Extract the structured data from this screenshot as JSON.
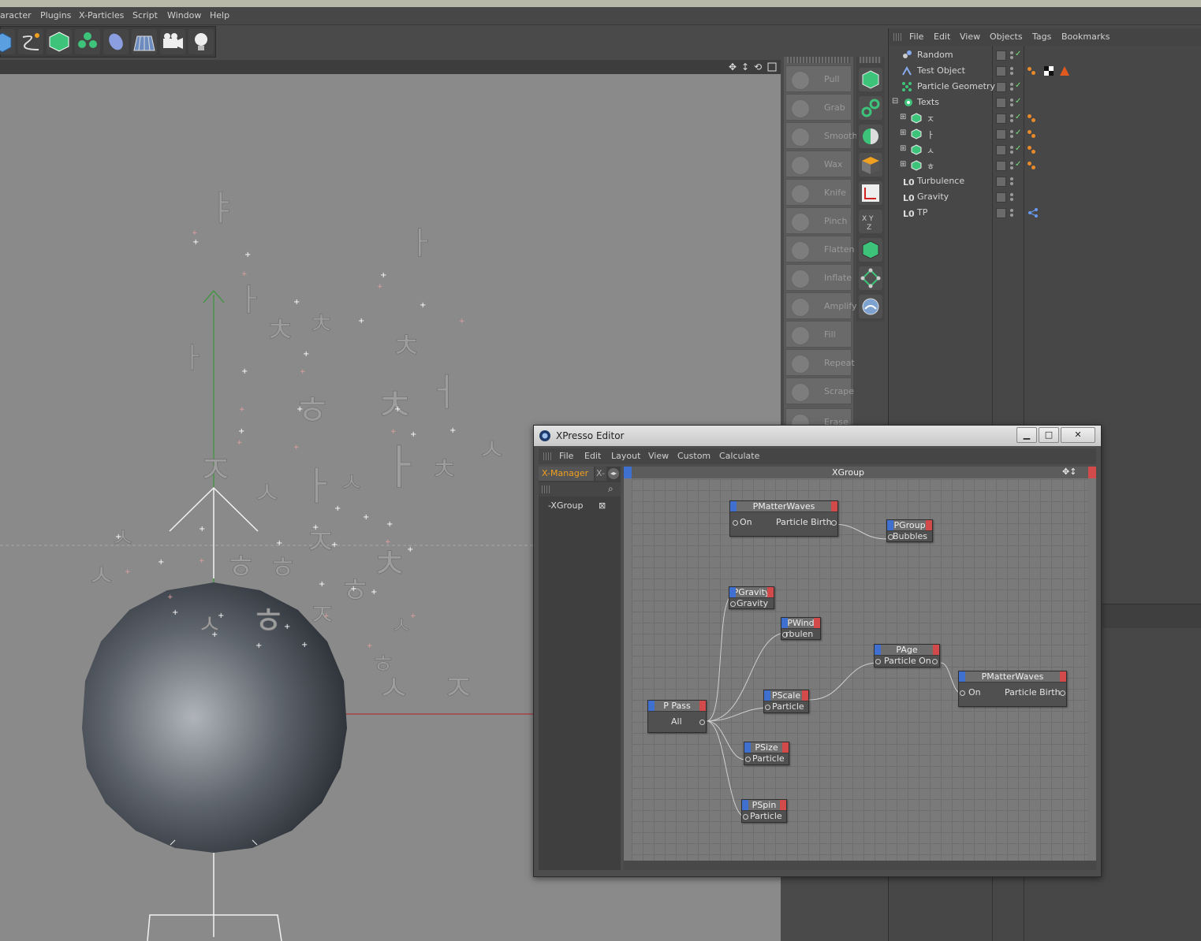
{
  "menubar": {
    "items": [
      "aracter",
      "Plugins",
      "X-Particles",
      "Script",
      "Window",
      "Help"
    ]
  },
  "sculpt": {
    "tools": [
      "Pull",
      "Grab",
      "Smooth",
      "Wax",
      "Knife",
      "Pinch",
      "Flatten",
      "Inflate",
      "Amplify",
      "Fill",
      "Repeat",
      "Scrape",
      "Erase"
    ]
  },
  "object_manager": {
    "menu": [
      "File",
      "Edit",
      "View",
      "Objects",
      "Tags",
      "Bookmarks"
    ],
    "objects": [
      {
        "name": "Random"
      },
      {
        "name": "Test Object"
      },
      {
        "name": "Particle Geometry"
      },
      {
        "name": "Texts"
      },
      {
        "name": "ㅈ"
      },
      {
        "name": "ㅏ"
      },
      {
        "name": "ㅅ"
      },
      {
        "name": "ㅎ"
      },
      {
        "name": "Turbulence"
      },
      {
        "name": "Gravity"
      },
      {
        "name": "TP"
      }
    ]
  },
  "xpresso": {
    "title": "XPresso Editor",
    "menu": [
      "File",
      "Edit",
      "Layout",
      "View",
      "Custom",
      "Calculate"
    ],
    "tabs": [
      "X-Manager",
      "X-"
    ],
    "tree_item": "-XGroup",
    "graph_title": "XGroup",
    "nodes": {
      "pmw1": {
        "title": "PMatterWaves",
        "in": "On",
        "out": "Particle Birth"
      },
      "pgroup": {
        "title": "PGroup",
        "port": "Bubbles"
      },
      "pgravity": {
        "title": "PGravity",
        "port": "Gravity"
      },
      "pwind": {
        "title": "PWind",
        "port": "rbulen"
      },
      "page": {
        "title": "PAge",
        "port": "Particle On"
      },
      "pmw2": {
        "title": "PMatterWaves",
        "in": "On",
        "out": "Particle Birth"
      },
      "ppass": {
        "title": "P Pass",
        "port": "All"
      },
      "pscale": {
        "title": "PScale",
        "port": "Particle"
      },
      "psize": {
        "title": "PSize",
        "port": "Particle"
      },
      "pspin": {
        "title": "PSpin",
        "port": "Particle"
      }
    }
  },
  "colors": {
    "accent_orange": "#f0a020",
    "node_in": "#3f6fcf",
    "node_out": "#d24a4a",
    "tag_orange": "#e88a2a",
    "check_green": "#78e078"
  }
}
